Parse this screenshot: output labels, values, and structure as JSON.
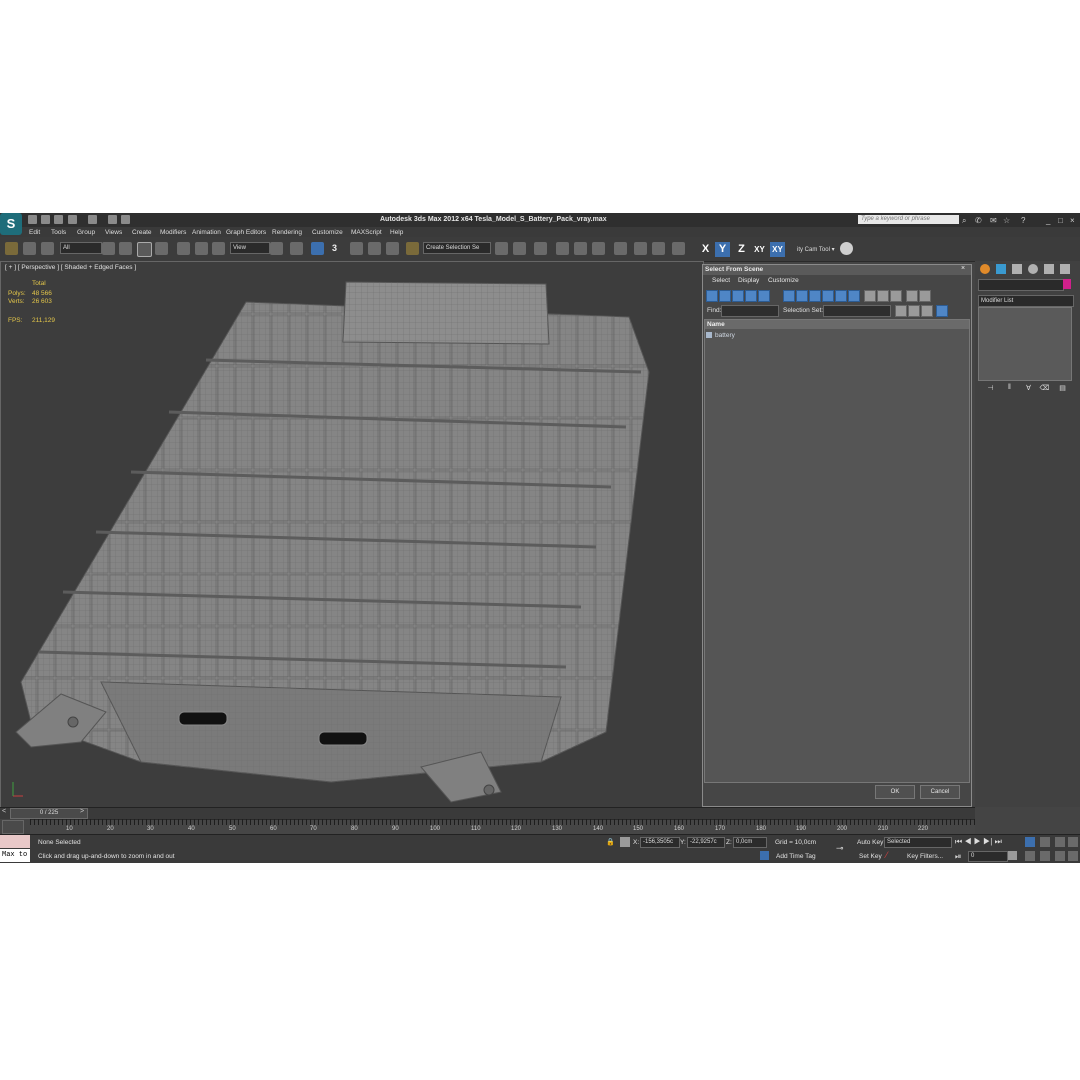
{
  "window": {
    "title": "Autodesk 3ds Max  2012 x64     Tesla_Model_S_Battery_Pack_vray.max",
    "search_placeholder": "Type a keyword or phrase",
    "logo_glyph": "S"
  },
  "menu": [
    "Edit",
    "Tools",
    "Group",
    "Views",
    "Create",
    "Modifiers",
    "Animation",
    "Graph Editors",
    "Rendering",
    "Customize",
    "MAXScript",
    "Help"
  ],
  "toolbar": {
    "selection_filter": "All",
    "ref_coord": "View",
    "snap_label": "3",
    "selection_set": "Create Selection Se",
    "axis": {
      "x": "X",
      "y": "Y",
      "z": "Z",
      "xy": "XY",
      "xy2": "XY"
    },
    "cam_tool": "ity Cam Tool ▾"
  },
  "viewport": {
    "label": "[ + ] [ Perspective ] [ Shaded + Edged Faces ]",
    "stats_header": "Total",
    "polys_label": "Polys:",
    "polys_value": "48 566",
    "verts_label": "Verts:",
    "verts_value": "26 603",
    "fps_label": "FPS:",
    "fps_value": "211,129"
  },
  "dialog": {
    "title": "Select From Scene",
    "menu": [
      "Select",
      "Display",
      "Customize"
    ],
    "find_label": "Find:",
    "find_value": "",
    "selection_set_label": "Selection Set:",
    "column_name": "Name",
    "items": [
      "battery"
    ],
    "ok_label": "OK",
    "cancel_label": "Cancel"
  },
  "command_panel": {
    "modifier_list": "Modifier List",
    "swatch_color": "#d0208c"
  },
  "timeline": {
    "frame_label": "0 / 225",
    "ticks": [
      "10",
      "20",
      "30",
      "40",
      "50",
      "60",
      "70",
      "80",
      "90",
      "100",
      "110",
      "120",
      "130",
      "140",
      "150",
      "160",
      "170",
      "180",
      "190",
      "200",
      "210",
      "220"
    ]
  },
  "status": {
    "maxscript": "Max to",
    "selection": "None Selected",
    "prompt": "Click and drag up-and-down to zoom in and out",
    "x_label": "X:",
    "x_value": "-156,3505c",
    "y_label": "Y:",
    "y_value": "-22,9257c",
    "z_label": "Z:",
    "z_value": "0,0cm",
    "grid": "Grid = 10,0cm",
    "add_time_tag": "Add Time Tag",
    "auto_key": "Auto Key",
    "auto_key_mode": "Selected",
    "set_key": "Set Key",
    "key_filters": "Key Filters...",
    "frame": "0"
  }
}
